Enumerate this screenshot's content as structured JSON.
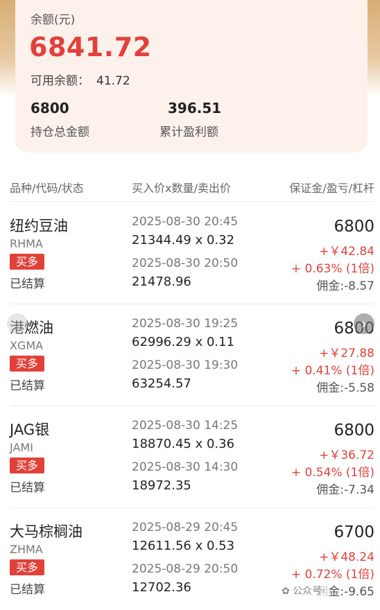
{
  "summary": {
    "balance_label": "余额(元)",
    "balance_value": "6841.72",
    "available_label": "可用余额：",
    "available_value": "41.72",
    "position_total_value": "6800",
    "position_total_label": "持仓总金额",
    "cumulative_profit_value": "396.51",
    "cumulative_profit_label": "累计盈利额"
  },
  "table_header": {
    "col1": "品种/代码/状态",
    "col2": "买入价x数量/卖出价",
    "col3": "保证金/盈亏/杠杆"
  },
  "trades": [
    {
      "name": "纽约豆油",
      "code": "RHMA",
      "direction": "买多",
      "status": "已结算",
      "buy_time": "2025-08-30 20:45",
      "buy_price_qty": "21344.49 x 0.32",
      "sell_time": "2025-08-30 20:50",
      "sell_price": "21478.96",
      "margin": "6800",
      "pnl": "+￥42.84",
      "pnl_pct": "+ 0.63% (1倍)",
      "fee": "佣金:-8.57"
    },
    {
      "name": "港燃油",
      "code": "XGMA",
      "direction": "买多",
      "status": "已结算",
      "buy_time": "2025-08-30 19:25",
      "buy_price_qty": "62996.29 x 0.11",
      "sell_time": "2025-08-30 19:30",
      "sell_price": "63254.57",
      "margin": "6800",
      "pnl": "+￥27.88",
      "pnl_pct": "+ 0.41% (1倍)",
      "fee": "佣金:-5.58"
    },
    {
      "name": "JAG银",
      "code": "JAMI",
      "direction": "买多",
      "status": "已结算",
      "buy_time": "2025-08-30 14:25",
      "buy_price_qty": "18870.45 x 0.36",
      "sell_time": "2025-08-30 14:30",
      "sell_price": "18972.35",
      "margin": "6800",
      "pnl": "+￥36.72",
      "pnl_pct": "+ 0.54% (1倍)",
      "fee": "佣金:-7.34"
    },
    {
      "name": "大马棕榈油",
      "code": "ZHMA",
      "direction": "买多",
      "status": "已结算",
      "buy_time": "2025-08-29 20:45",
      "buy_price_qty": "12611.56 x 0.53",
      "sell_time": "2025-08-29 20:50",
      "sell_price": "12702.36",
      "margin": "6700",
      "pnl": "+￥48.24",
      "pnl_pct": "+ 0.72% (1倍)",
      "fee": "佣金:-9.65"
    }
  ],
  "watermark": "公众号·"
}
